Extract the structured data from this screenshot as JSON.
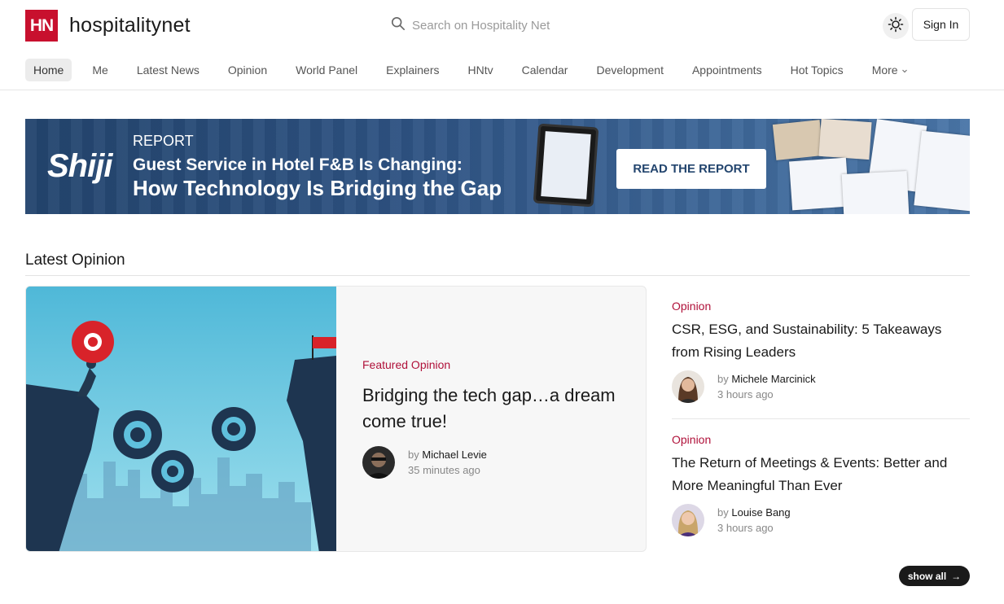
{
  "header": {
    "logo_mark": "HN",
    "logo_text": "hospitalitynet",
    "search_placeholder": "Search on Hospitality Net",
    "sign_in_label": "Sign In",
    "theme_icon": "sun-icon"
  },
  "nav": {
    "items": [
      {
        "label": "Home",
        "active": true
      },
      {
        "label": "Me"
      },
      {
        "label": "Latest News"
      },
      {
        "label": "Opinion"
      },
      {
        "label": "World Panel"
      },
      {
        "label": "Explainers"
      },
      {
        "label": "HNtv"
      },
      {
        "label": "Calendar"
      },
      {
        "label": "Development"
      },
      {
        "label": "Appointments"
      },
      {
        "label": "Hot Topics"
      },
      {
        "label": "More"
      }
    ]
  },
  "banner": {
    "brand": "Shiji",
    "kicker": "REPORT",
    "line1": "Guest Service in Hotel F&B Is Changing:",
    "line2": "How Technology Is Bridging the Gap",
    "cta_label": "READ THE REPORT"
  },
  "section": {
    "title": "Latest Opinion",
    "show_all_label": "show all"
  },
  "featured": {
    "kicker": "Featured Opinion",
    "title": "Bridging the tech gap…a dream come true!",
    "by": "by",
    "author": "Michael Levie",
    "time": "35 minutes ago"
  },
  "side_articles": [
    {
      "kicker": "Opinion",
      "title": "CSR, ESG, and Sustainability: 5 Takeaways from Rising Leaders",
      "by": "by",
      "author": "Michele Marcinick",
      "time": "3 hours ago"
    },
    {
      "kicker": "Opinion",
      "title": "The Return of Meetings & Events: Better and More Meaningful Than Ever",
      "by": "by",
      "author": "Louise Bang",
      "time": "3 hours ago"
    }
  ],
  "colors": {
    "brand_red": "#c8102e",
    "kicker_red": "#b0113a",
    "banner_blue": "#2e5282"
  }
}
